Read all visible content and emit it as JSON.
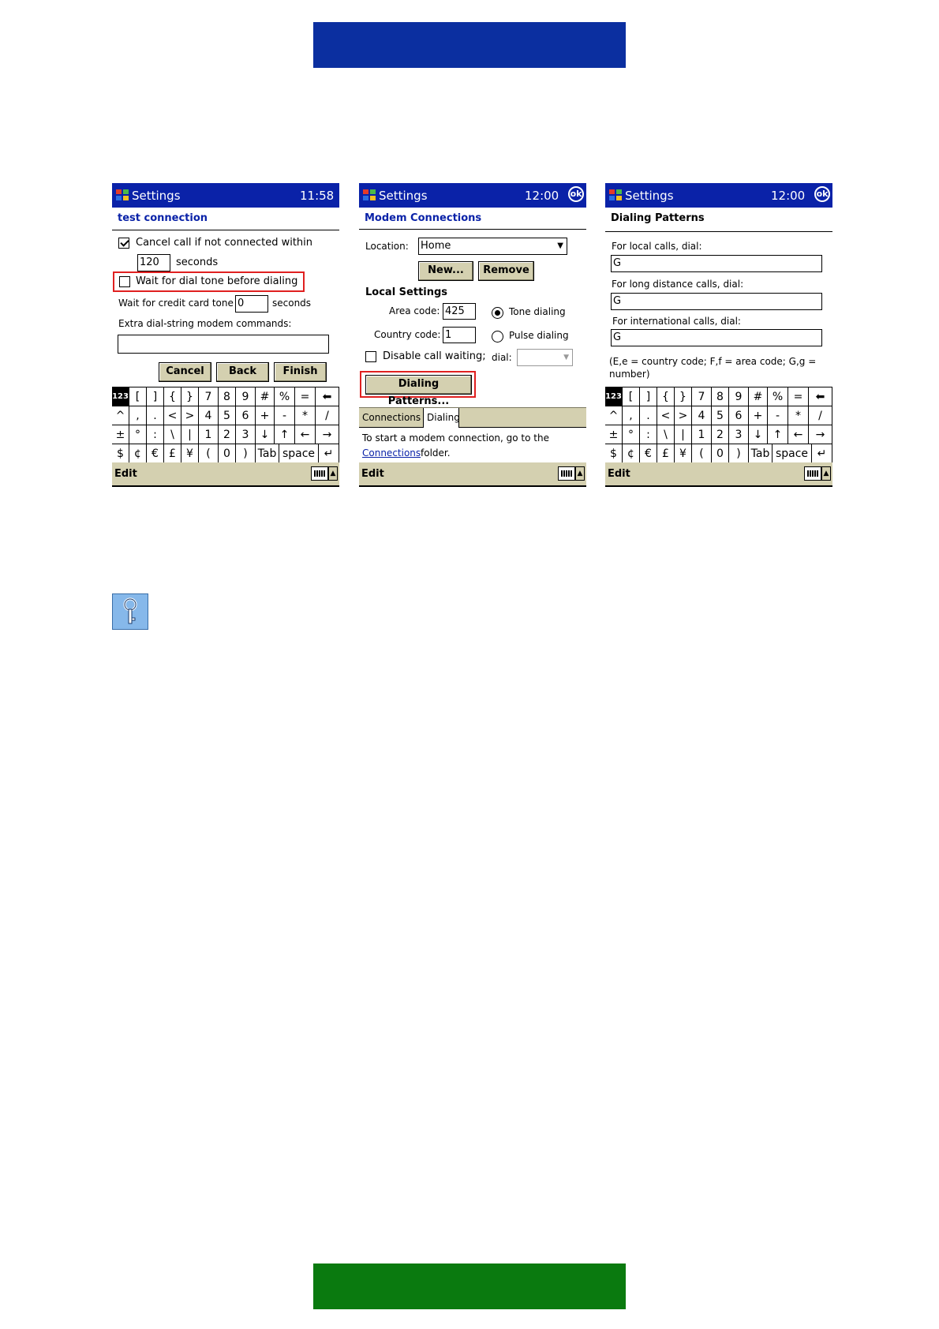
{
  "colors": {
    "top_banner": "#0b2fa0",
    "bottom_banner": "#0a7a0f",
    "titlebar": "#0a22a8",
    "highlight": "#e02020",
    "chrome": "#d4d0b0"
  },
  "screen1": {
    "app_title": "Settings",
    "time": "11:58",
    "subheading": "test connection",
    "cancel_call_label": "Cancel call if not connected within",
    "cancel_call_checked": true,
    "timeout_value": "120",
    "seconds_label": "seconds",
    "wait_dial_tone_label": "Wait for dial tone before dialing",
    "wait_dial_tone_checked": false,
    "credit_card_label": "Wait for credit card tone",
    "credit_card_value": "0",
    "credit_card_unit": "seconds",
    "extra_commands_label": "Extra dial-string modem commands:",
    "extra_commands_value": "",
    "cancel_button": "Cancel",
    "back_button": "Back",
    "finish_button": "Finish",
    "menu_edit": "Edit"
  },
  "screen2": {
    "app_title": "Settings",
    "time": "12:00",
    "ok_label": "ok",
    "subheading": "Modem Connections",
    "location_label": "Location:",
    "location_value": "Home",
    "new_button": "New...",
    "remove_button": "Remove",
    "local_settings_heading": "Local Settings",
    "area_code_label": "Area code:",
    "area_code_value": "425",
    "country_code_label": "Country code:",
    "country_code_value": "1",
    "tone_dialing_label": "Tone dialing",
    "pulse_dialing_label": "Pulse dialing",
    "selected_dialing": "Tone dialing",
    "disable_call_waiting_label": "Disable call waiting;",
    "dial_label": "dial:",
    "dial_value": "",
    "dialing_patterns_button": "Dialing Patterns...",
    "tabs": [
      "Connections",
      "Dialing"
    ],
    "active_tab": "Dialing",
    "info_text_prefix": "To start a modem connection, go to the",
    "info_link": "Connections",
    "info_text_suffix": "folder.",
    "menu_edit": "Edit"
  },
  "screen3": {
    "app_title": "Settings",
    "time": "12:00",
    "ok_label": "ok",
    "subheading": "Dialing Patterns",
    "local_label": "For local calls, dial:",
    "local_value": "G",
    "long_distance_label": "For long distance calls, dial:",
    "long_distance_value": "G",
    "international_label": "For international calls, dial:",
    "international_value": "G",
    "legend_line1": "(E,e = country code; F,f = area code; G,g =",
    "legend_line2": "number)",
    "menu_edit": "Edit"
  },
  "keyboard": {
    "rows": [
      [
        "123",
        "[",
        "]",
        "{",
        "}",
        "7",
        "8",
        "9",
        "#",
        "%",
        "=",
        "⬅"
      ],
      [
        "^",
        ",",
        ".",
        "<",
        ">",
        "4",
        "5",
        "6",
        "+",
        "-",
        "*",
        "/"
      ],
      [
        "±",
        "°",
        ":",
        "\\",
        "|",
        "1",
        "2",
        "3",
        "↓",
        "↑",
        "←",
        "→"
      ],
      [
        "$",
        "¢",
        "€",
        "£",
        "¥",
        "(",
        "0",
        ")",
        "Tab",
        "space",
        "↵"
      ]
    ]
  },
  "icons": {
    "tip": "key-icon",
    "titlebar": "windows-flag-icon"
  }
}
